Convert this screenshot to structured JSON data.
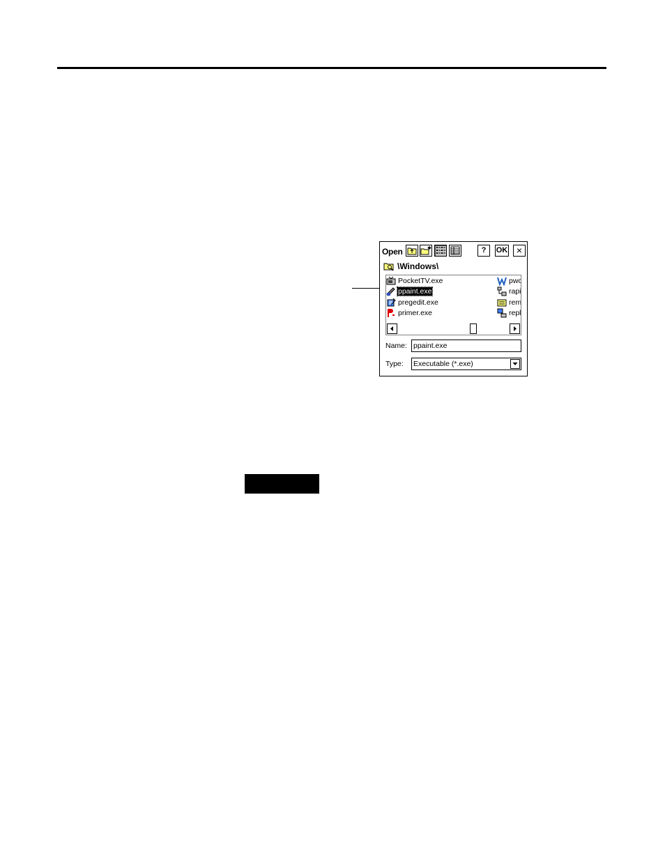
{
  "dialog": {
    "title": "Open",
    "toolbar": {
      "help_label": "?",
      "ok_label": "OK",
      "close_label": "×"
    },
    "path": "\\Windows\\",
    "files_left": [
      "PocketTV.exe",
      "ppaint.exe",
      "pregedit.exe",
      "primer.exe"
    ],
    "files_right": [
      "pwc",
      "rapi",
      "rem",
      "repl"
    ],
    "selected_file": "ppaint.exe",
    "name_label": "Name:",
    "name_value": "ppaint.exe",
    "type_label": "Type:",
    "type_value": "Executable (*.exe)",
    "icons": {
      "up-folder": "up-folder-icon",
      "new-folder": "new-folder-icon",
      "list-view": "list-view-icon",
      "details-view": "details-view-icon"
    }
  }
}
